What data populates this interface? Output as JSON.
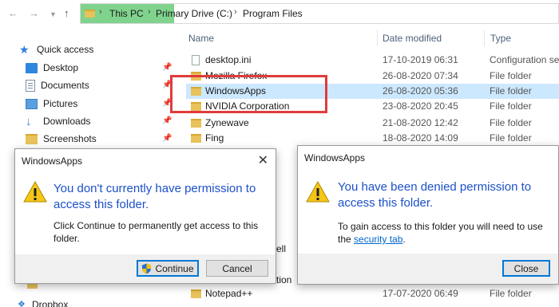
{
  "address": {
    "crumbs": [
      "This PC",
      "Primary Drive (C:)",
      "Program Files"
    ],
    "separators": [
      "›",
      "›",
      "›"
    ]
  },
  "sidebar": {
    "items": [
      {
        "label": "Quick access",
        "icon": "star-icon",
        "pinned": false
      },
      {
        "label": "Desktop",
        "icon": "desktop-icon",
        "pinned": true
      },
      {
        "label": "Documents",
        "icon": "documents-icon",
        "pinned": true
      },
      {
        "label": "Pictures",
        "icon": "pictures-icon",
        "pinned": true
      },
      {
        "label": "Downloads",
        "icon": "download-icon",
        "pinned": true
      },
      {
        "label": "Screenshots",
        "icon": "folder-icon",
        "pinned": true
      }
    ],
    "pin_glyph": "📌"
  },
  "file_list": {
    "columns": {
      "name": "Name",
      "date": "Date modified",
      "type": "Type"
    },
    "rows": [
      {
        "name": "desktop.ini",
        "date": "17-10-2019 06:31",
        "type": "Configuration set",
        "icon": "file-icon"
      },
      {
        "name": "Mozilla Firefox",
        "date": "26-08-2020 07:34",
        "type": "File folder",
        "icon": "folder-icon"
      },
      {
        "name": "WindowsApps",
        "date": "26-08-2020 05:36",
        "type": "File folder",
        "icon": "folder-icon",
        "selected": true
      },
      {
        "name": "NVIDIA Corporation",
        "date": "23-08-2020 20:45",
        "type": "File folder",
        "icon": "folder-icon"
      },
      {
        "name": "Zynewave",
        "date": "21-08-2020 12:42",
        "type": "File folder",
        "icon": "folder-icon"
      },
      {
        "name": "Fing",
        "date": "18-08-2020 14:09",
        "type": "File folder",
        "icon": "folder-icon"
      },
      {
        "name": "Notepad++",
        "date": "17-07-2020 06:49",
        "type": "File folder",
        "icon": "folder-icon"
      }
    ],
    "partial_texts": [
      "ell",
      "tion"
    ],
    "partial_sidebar": "Dropbox"
  },
  "dialog_permission": {
    "title": "WindowsApps",
    "close_glyph": "✕",
    "main_text": "You don't currently have permission to access this folder.",
    "body_text": "Click Continue to permanently get access to this folder.",
    "continue_label": "Continue",
    "cancel_label": "Cancel"
  },
  "dialog_denied": {
    "title": "WindowsApps",
    "main_text": "You have been denied permission to access this folder.",
    "body_text": "To gain access to this folder you will need to use the",
    "link_text": "security tab",
    "link_suffix": ".",
    "close_label": "Close"
  },
  "colors": {
    "highlight_crumb": "#7fd38d",
    "annotation_box": "#e03b3b",
    "dialog_heading": "#1c50c8",
    "selection": "#cce8ff"
  }
}
